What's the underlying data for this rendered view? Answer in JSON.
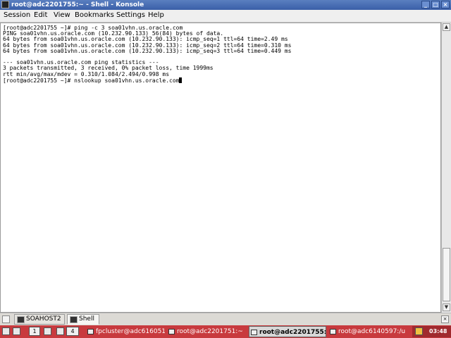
{
  "window": {
    "title": "root@adc2201755:~ - Shell - Konsole",
    "buttons": [
      "minimize-icon",
      "maximize-icon",
      "close-icon"
    ]
  },
  "menu": [
    "Session",
    "Edit",
    "View",
    "Bookmarks",
    "Settings",
    "Help"
  ],
  "terminal": {
    "lines": [
      "[root@adc2201755 ~]# ping -c 3 soa01vhn.us.oracle.com",
      "PING soa01vhn.us.oracle.com (10.232.90.133) 56(84) bytes of data.",
      "64 bytes from soa01vhn.us.oracle.com (10.232.90.133): icmp_seq=1 ttl=64 time=2.49 ms",
      "64 bytes from soa01vhn.us.oracle.com (10.232.90.133): icmp_seq=2 ttl=64 time=0.310 ms",
      "64 bytes from soa01vhn.us.oracle.com (10.232.90.133): icmp_seq=3 ttl=64 time=0.449 ms",
      "",
      "--- soa01vhn.us.oracle.com ping statistics ---",
      "3 packets transmitted, 3 received, 0% packet loss, time 1999ms",
      "rtt min/avg/max/mdev = 0.310/1.084/2.494/0.998 ms",
      "[root@adc2201755 ~]# nslookup soa01vhn.us.oracle.com"
    ],
    "scroll_position": 1.0
  },
  "tabs": [
    {
      "label": "SOAHOST2",
      "active": false
    },
    {
      "label": "Shell",
      "active": true
    }
  ],
  "taskbar": {
    "pager": [
      "1",
      "4"
    ],
    "tasks": [
      {
        "label": "fpcluster@adc6160511",
        "active": false
      },
      {
        "label": "root@adc2201751:~",
        "active": false
      },
      {
        "label": "root@adc2201755:",
        "active": true
      },
      {
        "label": "root@adc6140597:/u",
        "active": false
      }
    ],
    "clock": "03:48"
  },
  "colors": {
    "titlebar": "#3a5fa8",
    "taskbar": "#c83a3e",
    "terminal_bg": "#ffffff",
    "terminal_fg": "#000000"
  }
}
